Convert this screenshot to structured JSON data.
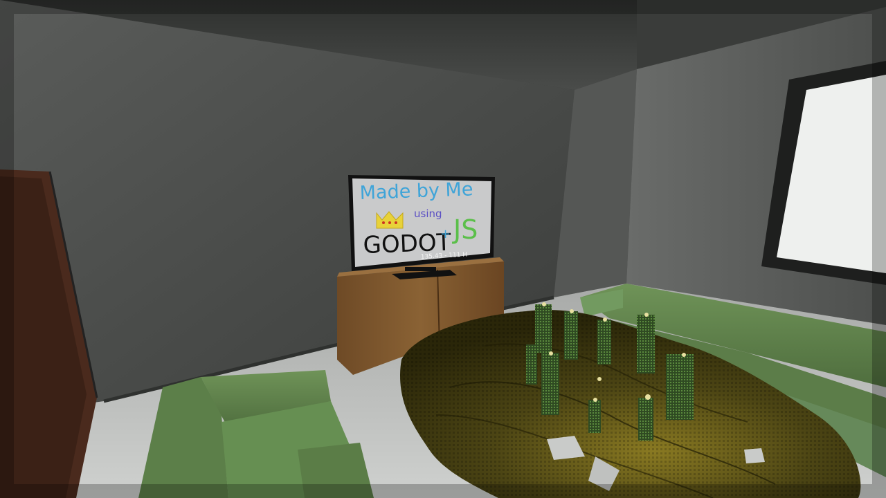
{
  "scene": {
    "tv": {
      "line1": "Made by Me",
      "line2": "using",
      "line3": "GODOT",
      "plus": "+",
      "line4": "JS",
      "caption": "135.43 - 111 H"
    },
    "colors": {
      "wall": "#4a4c4a",
      "sofa": "#5e7f4c",
      "terrain": "#3f3a12",
      "tower": "#3f5a2e",
      "window": "#eef0ee",
      "door": "#4a2a1d",
      "tv_text_blue": "#3fa4d8",
      "tv_text_green": "#5bbf4a",
      "crown": "#e8d23a"
    }
  }
}
